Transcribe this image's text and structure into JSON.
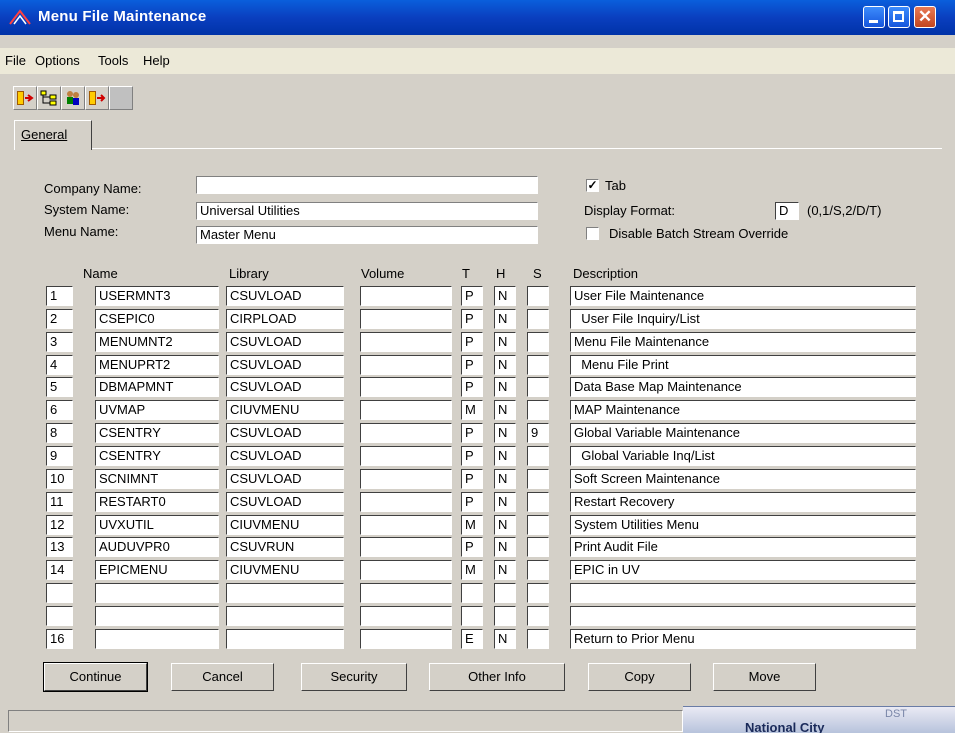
{
  "window": {
    "title": "Menu File Maintenance"
  },
  "menu": [
    "File",
    "Options",
    "Tools",
    "Help"
  ],
  "toolbar": [
    "exit-icon",
    "tree-icon",
    "users-icon",
    "next-icon",
    "blank-icon"
  ],
  "tabs": {
    "general": "General"
  },
  "form": {
    "company_label": "Company Name:",
    "company_value": "",
    "system_label": "System Name:",
    "system_value": "Universal Utilities",
    "menu_label": "Menu Name:",
    "menu_value": "Master Menu",
    "tab_label": "Tab",
    "tab_checked": true,
    "display_label": "Display Format:",
    "display_value": "D",
    "display_hint": "(0,1/S,2/D/T)",
    "disable_label": "Disable Batch Stream Override",
    "disable_checked": false
  },
  "table": {
    "headers": {
      "name": "Name",
      "library": "Library",
      "volume": "Volume",
      "t": "T",
      "h": "H",
      "s": "S",
      "description": "Description"
    },
    "rows": [
      {
        "num": "1",
        "name": "USERMNT3",
        "library": "CSUVLOAD",
        "volume": "",
        "t": "P",
        "h": "N",
        "s": "",
        "description": "User File Maintenance"
      },
      {
        "num": "2",
        "name": "CSEPIC0",
        "library": "CIRPLOAD",
        "volume": "",
        "t": "P",
        "h": "N",
        "s": "",
        "description": "  User File Inquiry/List"
      },
      {
        "num": "3",
        "name": "MENUMNT2",
        "library": "CSUVLOAD",
        "volume": "",
        "t": "P",
        "h": "N",
        "s": "",
        "description": "Menu File Maintenance"
      },
      {
        "num": "4",
        "name": "MENUPRT2",
        "library": "CSUVLOAD",
        "volume": "",
        "t": "P",
        "h": "N",
        "s": "",
        "description": "  Menu File Print"
      },
      {
        "num": "5",
        "name": "DBMAPMNT",
        "library": "CSUVLOAD",
        "volume": "",
        "t": "P",
        "h": "N",
        "s": "",
        "description": "Data Base Map Maintenance"
      },
      {
        "num": "6",
        "name": "UVMAP",
        "library": "CIUVMENU",
        "volume": "",
        "t": "M",
        "h": "N",
        "s": "",
        "description": "MAP Maintenance"
      },
      {
        "num": "8",
        "name": "CSENTRY",
        "library": "CSUVLOAD",
        "volume": "",
        "t": "P",
        "h": "N",
        "s": "9",
        "description": "Global Variable Maintenance"
      },
      {
        "num": "9",
        "name": "CSENTRY",
        "library": "CSUVLOAD",
        "volume": "",
        "t": "P",
        "h": "N",
        "s": "",
        "description": "  Global Variable Inq/List"
      },
      {
        "num": "10",
        "name": "SCNIMNT",
        "library": "CSUVLOAD",
        "volume": "",
        "t": "P",
        "h": "N",
        "s": "",
        "description": "Soft Screen Maintenance"
      },
      {
        "num": "11",
        "name": "RESTART0",
        "library": "CSUVLOAD",
        "volume": "",
        "t": "P",
        "h": "N",
        "s": "",
        "description": "Restart Recovery"
      },
      {
        "num": "12",
        "name": "UVXUTIL",
        "library": "CIUVMENU",
        "volume": "",
        "t": "M",
        "h": "N",
        "s": "",
        "description": "System Utilities Menu"
      },
      {
        "num": "13",
        "name": "AUDUVPR0",
        "library": "CSUVRUN",
        "volume": "",
        "t": "P",
        "h": "N",
        "s": "",
        "description": "Print Audit File"
      },
      {
        "num": "14",
        "name": "EPICMENU",
        "library": "CIUVMENU",
        "volume": "",
        "t": "M",
        "h": "N",
        "s": "",
        "description": "EPIC in UV"
      },
      {
        "num": "",
        "name": "",
        "library": "",
        "volume": "",
        "t": "",
        "h": "",
        "s": "",
        "description": ""
      },
      {
        "num": "",
        "name": "",
        "library": "",
        "volume": "",
        "t": "",
        "h": "",
        "s": "",
        "description": ""
      },
      {
        "num": "16",
        "name": "",
        "library": "",
        "volume": "",
        "t": "E",
        "h": "N",
        "s": "",
        "description": "Return to Prior Menu"
      }
    ]
  },
  "buttons": {
    "continue": "Continue",
    "cancel": "Cancel",
    "security": "Security",
    "other_info": "Other Info",
    "copy": "Copy",
    "move": "Move"
  },
  "taskbar": {
    "text": "National City",
    "text2": "DST"
  }
}
